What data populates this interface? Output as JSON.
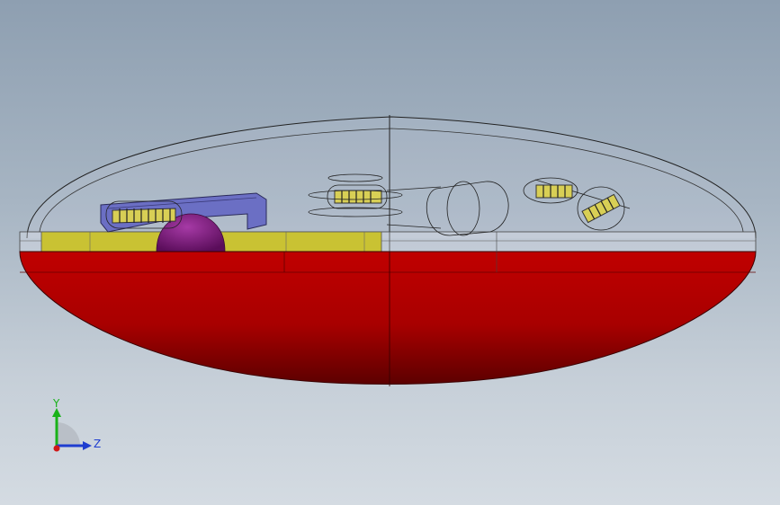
{
  "viewport": {
    "background_top": "#8e9fb1",
    "background_bottom": "#d4dbe2"
  },
  "model": {
    "shell_color": "#c00000",
    "shell_dark": "#7a0000",
    "base_plate_color": "#c9c233",
    "bracket_color": "#6b6fc4",
    "dome_color": "#8a1a8a",
    "coil_color": "#d8cf55",
    "outline_color": "#1a1a1a"
  },
  "triad": {
    "y_label": "Y",
    "z_label": "Z",
    "y_color": "#19b219",
    "z_color": "#1e3dd0",
    "x_color": "#d01818"
  }
}
